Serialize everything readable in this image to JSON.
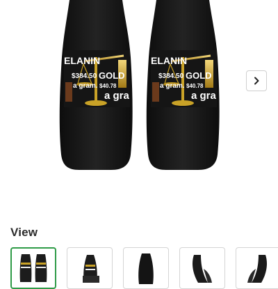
{
  "product": {
    "design_text": {
      "brand": "ELANIN",
      "price_left": "$384.50",
      "per_gram_left": "a gram.",
      "gold": "GOLD",
      "price_right": "$40.78",
      "per_gram_right": "a gra"
    },
    "seat_color": "#1c1c1c",
    "gold_color": "#c9a227"
  },
  "gallery": {
    "next_icon": "chevron-right-icon"
  },
  "view": {
    "heading": "View",
    "thumbnails": [
      {
        "name": "front-pair",
        "selected": true
      },
      {
        "name": "front-angle",
        "selected": false
      },
      {
        "name": "back",
        "selected": false
      },
      {
        "name": "side-left",
        "selected": false
      },
      {
        "name": "side-right",
        "selected": false
      }
    ]
  },
  "accent_color": "#2e9b47"
}
